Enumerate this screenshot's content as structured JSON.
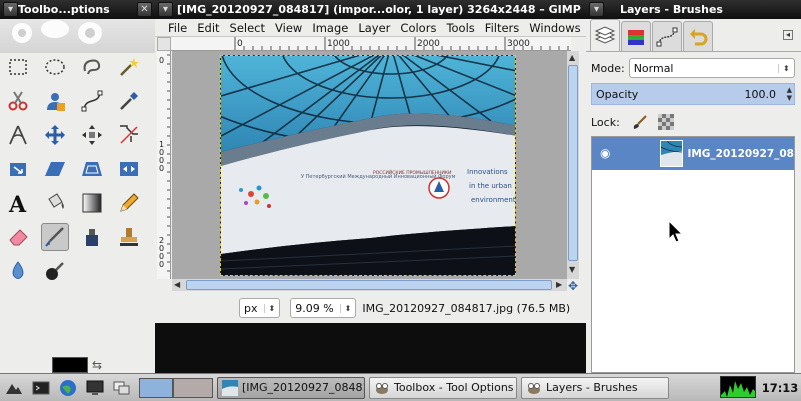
{
  "toolbox": {
    "title": "Toolbo...ptions",
    "tools": [
      "rect-select-icon",
      "ellipse-select-icon",
      "free-select-icon",
      "fuzzy-select-icon",
      "color-select-icon",
      "scissors-select-icon",
      "foreground-select-icon",
      "paths-icon",
      "color-picker-icon",
      "zoom-icon",
      "measure-icon",
      "move-icon",
      "align-icon",
      "crop-icon",
      "rotate-icon",
      "scale-icon",
      "shear-icon",
      "perspective-icon",
      "flip-icon",
      "cage-icon",
      "text-icon",
      "bucket-fill-icon",
      "blend-icon",
      "pencil-icon",
      "paintbrush-icon",
      "eraser-icon",
      "airbrush-icon",
      "ink-icon",
      "clone-icon",
      "heal-icon",
      "smudge-icon",
      "dodge-burn-icon"
    ],
    "active_tool": "airbrush-icon"
  },
  "image_window": {
    "title": "[IMG_20120927_084817] (impor...olor, 1 layer) 3264x2448 – GIMP",
    "menu": [
      "File",
      "Edit",
      "Select",
      "View",
      "Image",
      "Layer",
      "Colors",
      "Tools",
      "Filters",
      "Windows",
      "He"
    ],
    "ruler_h_labels": [
      "0",
      "1000",
      "2000",
      "3000"
    ],
    "ruler_v_labels": [
      "0",
      "1",
      "0",
      "0",
      "0",
      "2",
      "0",
      "0",
      "0"
    ],
    "unit": "px",
    "zoom": "9.09 %",
    "status": "IMG_20120927_084817.jpg (76.5 MB)",
    "photo_text": {
      "banner_left": "У Петербургский Международный Инновационный Форум",
      "banner_mid": "РОССИЙСКИЕ ПРОМЫШЛЕННИКИ",
      "banner_right_1": "Innovations",
      "banner_right_2": "in the urban",
      "banner_right_3": "environment"
    }
  },
  "layers_panel": {
    "title": "Layers - Brushes",
    "tabs": [
      "layers-icon",
      "channels-icon",
      "paths-icon",
      "undo-icon"
    ],
    "mode_label": "Mode:",
    "mode_value": "Normal",
    "opacity_label": "Opacity",
    "opacity_value": "100.0",
    "opacity_fraction": 1.0,
    "lock_label": "Lock:",
    "layers": [
      {
        "name": "IMG_20120927_08"
      }
    ]
  },
  "taskbar": {
    "tasks": [
      {
        "label": "[IMG_20120927_084817]",
        "icon": "image-thumb-icon",
        "active": true
      },
      {
        "label": "Toolbox - Tool Options",
        "icon": "gimp-icon",
        "active": false
      },
      {
        "label": "Layers - Brushes",
        "icon": "gimp-icon",
        "active": false
      }
    ],
    "clock": "17:13"
  },
  "colors": {
    "accent": "#5b86c5",
    "titlebar": "#1a1a1a"
  }
}
